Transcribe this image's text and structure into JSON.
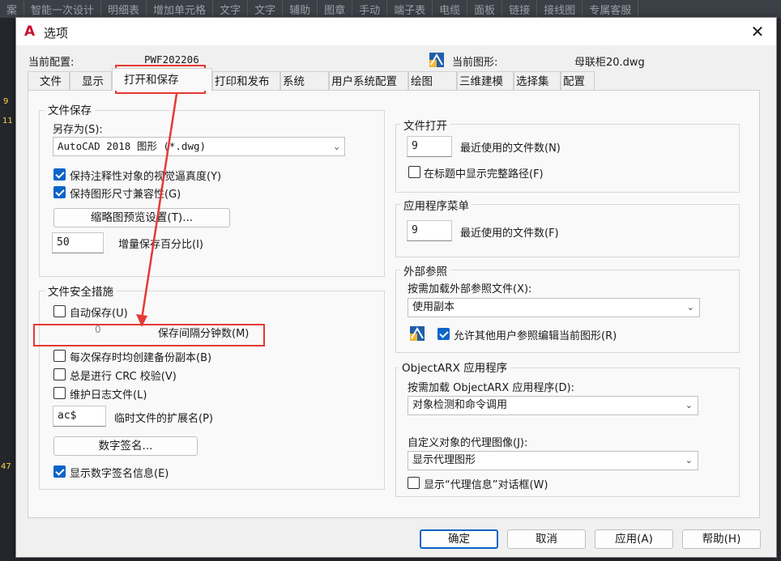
{
  "background": {
    "menu_items": [
      "案",
      "智能一次设计",
      "明细表",
      "增加单元格",
      "文字",
      "文字",
      "辅助",
      "图章",
      "手动",
      "端子表",
      "电缆",
      "面板",
      "链接",
      "接线图",
      "专属客服"
    ],
    "left_marks": [
      "9",
      "11",
      "47"
    ]
  },
  "dialog": {
    "title": "选项",
    "app_icon": "A",
    "close_glyph": "✕",
    "current_profile_label": "当前配置:",
    "current_profile_value": "PWF202206",
    "current_drawing_label": "当前图形:",
    "current_drawing_value": "母联柜20.dwg"
  },
  "tabs": [
    "文件",
    "显示",
    "打开和保存",
    "打印和发布",
    "系统",
    "用户系统配置",
    "绘图",
    "三维建模",
    "选择集",
    "配置"
  ],
  "active_tab": "打开和保存",
  "file_save": {
    "title": "文件保存",
    "save_as_label": "另存为(S):",
    "save_as_value": "AutoCAD 2018 图形 (*.dwg)",
    "cb_annotative": {
      "label": "保持注释性对象的视觉逼真度(Y)",
      "checked": true
    },
    "cb_size_compat": {
      "label": "保持图形尺寸兼容性(G)",
      "checked": true
    },
    "thumbnail_button": "缩略图预览设置(T)...",
    "incremental_value": "50",
    "incremental_label": "增量保存百分比(I)"
  },
  "file_safety": {
    "title": "文件安全措施",
    "cb_autosave": {
      "label": "自动保存(U)",
      "checked": false
    },
    "minutes_value": "0",
    "minutes_label": "保存间隔分钟数(M)",
    "cb_backup": {
      "label": "每次保存时均创建备份副本(B)",
      "checked": false
    },
    "cb_crc": {
      "label": "总是进行 CRC 校验(V)",
      "checked": false
    },
    "cb_log": {
      "label": "维护日志文件(L)",
      "checked": false
    },
    "temp_ext_value": "ac$",
    "temp_ext_label": "临时文件的扩展名(P)",
    "digital_sig_button": "数字签名...",
    "cb_show_sig": {
      "label": "显示数字签名信息(E)",
      "checked": true
    }
  },
  "file_open": {
    "title": "文件打开",
    "recent_value": "9",
    "recent_label": "最近使用的文件数(N)",
    "cb_full_path": {
      "label": "在标题中显示完整路径(F)",
      "checked": false
    }
  },
  "app_menu": {
    "title": "应用程序菜单",
    "recent_value": "9",
    "recent_label": "最近使用的文件数(F)"
  },
  "xref": {
    "title": "外部参照",
    "demand_label": "按需加载外部参照文件(X):",
    "demand_value": "使用副本",
    "cb_allow_edit": {
      "label": "允许其他用户参照编辑当前图形(R)",
      "checked": true
    }
  },
  "objectarx": {
    "title": "ObjectARX 应用程序",
    "demand_label": "按需加载 ObjectARX 应用程序(D):",
    "demand_value": "对象检测和命令调用",
    "proxy_label": "自定义对象的代理图像(J):",
    "proxy_value": "显示代理图形",
    "cb_proxy_info": {
      "label": "显示“代理信息”对话框(W)",
      "checked": false
    }
  },
  "footer": {
    "ok": "确定",
    "cancel": "取消",
    "apply": "应用(A)",
    "help": "帮助(H)"
  },
  "colors": {
    "accent": "#0a64c8",
    "annotation": "#e53935",
    "autocad_red": "#c8102e"
  }
}
